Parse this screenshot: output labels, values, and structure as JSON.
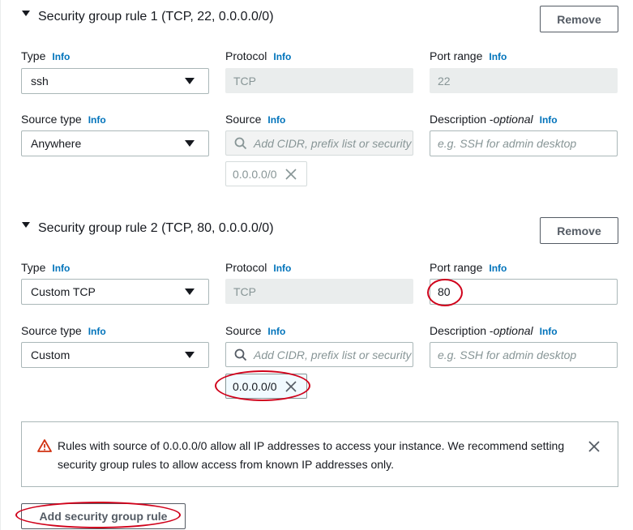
{
  "rules": [
    {
      "title": "Security group rule 1 (TCP, 22, 0.0.0.0/0)",
      "remove_label": "Remove",
      "type_label": "Type",
      "type_value": "ssh",
      "protocol_label": "Protocol",
      "protocol_value": "TCP",
      "port_label": "Port range",
      "port_value": "22",
      "source_type_label": "Source type",
      "source_type_value": "Anywhere",
      "source_label": "Source",
      "source_placeholder": "Add CIDR, prefix list or security",
      "source_token": "0.0.0.0/0",
      "description_label": "Description - ",
      "description_optional": "optional",
      "description_placeholder": "e.g. SSH for admin desktop"
    },
    {
      "title": "Security group rule 2 (TCP, 80, 0.0.0.0/0)",
      "remove_label": "Remove",
      "type_label": "Type",
      "type_value": "Custom TCP",
      "protocol_label": "Protocol",
      "protocol_value": "TCP",
      "port_label": "Port range",
      "port_value": "80",
      "source_type_label": "Source type",
      "source_type_value": "Custom",
      "source_label": "Source",
      "source_placeholder": "Add CIDR, prefix list or security",
      "source_token": "0.0.0.0/0",
      "description_label": "Description - ",
      "description_optional": "optional",
      "description_placeholder": "e.g. SSH for admin desktop"
    }
  ],
  "info_link": "Info",
  "warning": {
    "line1": "Rules with source of 0.0.0.0/0 allow all IP addresses to access your instance. We recommend setting",
    "line2": "security group rules to allow access from known IP addresses only."
  },
  "add_rule_label": "Add security group rule",
  "colors": {
    "accent_link": "#0073bb",
    "annotation_red": "#d0021b",
    "warning_red": "#d13212"
  }
}
